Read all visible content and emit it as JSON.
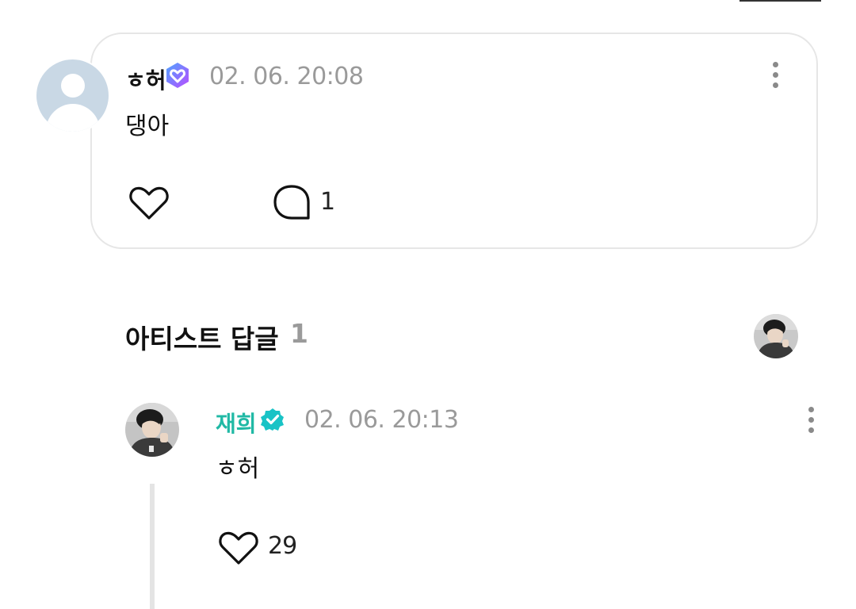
{
  "comment": {
    "author": "ㅎ허",
    "badge_icon": "verified-heart-badge",
    "timestamp": "02. 06. 20:08",
    "text": "댕아",
    "reply_count": "1"
  },
  "artist_replies": {
    "title": "아티스트 답글",
    "count": "1"
  },
  "reply": {
    "author": "재희",
    "author_color": "#20b9a5",
    "badge_icon": "verified-check-badge",
    "timestamp": "02. 06. 20:13",
    "text": "ㅎ허",
    "like_count": "29"
  },
  "colors": {
    "muted": "#9a9a9a",
    "card_border": "#e6e6e6",
    "badge_purple": "#8b4dff",
    "badge_teal": "#19c3c6"
  }
}
